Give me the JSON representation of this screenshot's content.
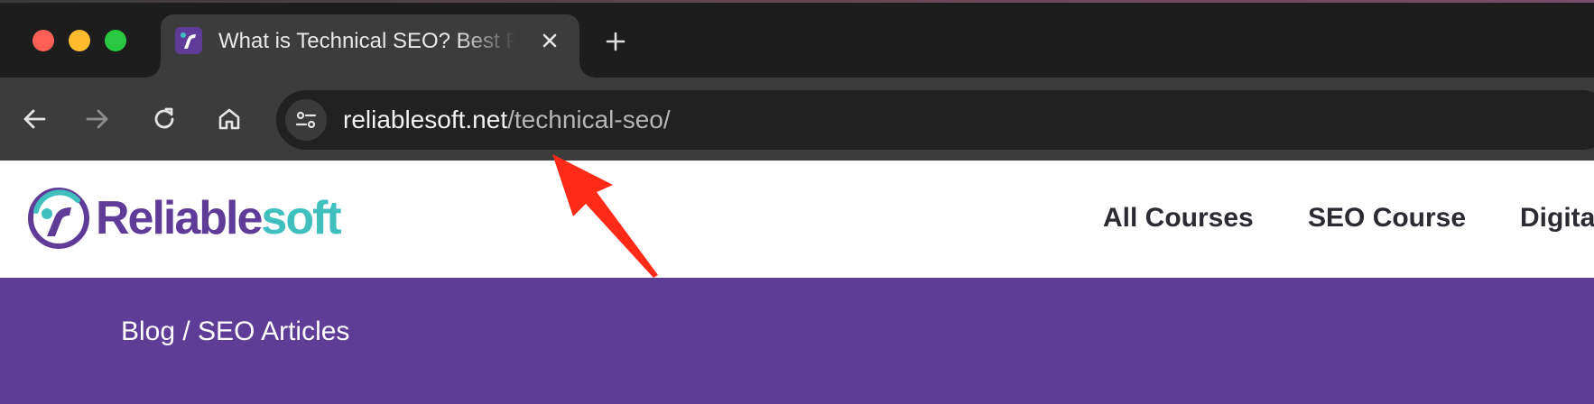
{
  "browser": {
    "tab": {
      "title": "What is Technical SEO? Best Practices"
    },
    "address_bar": {
      "host": "reliablesoft.net",
      "path": "/technical-seo/"
    },
    "icons": [
      "close-icon",
      "plus-icon",
      "back-icon",
      "forward-icon",
      "reload-icon",
      "home-icon",
      "site-info-icon"
    ]
  },
  "site": {
    "logo": {
      "part1": "Reliable",
      "part2": "soft"
    },
    "nav": [
      "All Courses",
      "SEO Course",
      "Digita"
    ],
    "breadcrumb": "Blog / SEO Articles"
  },
  "colors": {
    "brand_purple": "#5e3d96",
    "brand_teal": "#40bfbf",
    "annotation_red": "#ff2a17"
  }
}
